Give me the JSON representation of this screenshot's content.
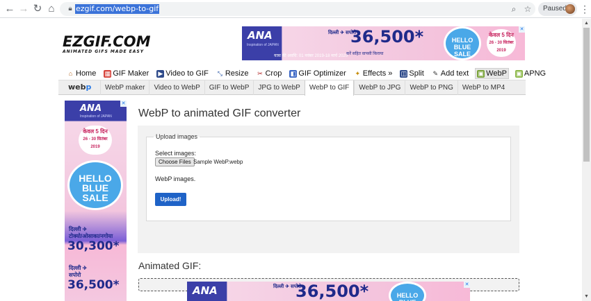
{
  "browser": {
    "back_icon": "back-arrow-icon",
    "forward_icon": "forward-arrow-icon",
    "reload_icon": "reload-icon",
    "home_icon": "home-icon",
    "url": "ezgif.com/webp-to-gif",
    "profile_status": "Paused"
  },
  "site": {
    "logo_word": "EZGIF.COM",
    "logo_tagline": "ANIMATED GIFS MADE EASY"
  },
  "ad_top": {
    "brand": "ANA",
    "tagline": "Inspiration of JAPAN",
    "city": "दिल्ली ✈ सपोरो",
    "price": "36,500*",
    "note": "करें सहित वापसी किराया",
    "period": "यात्रा की अवधि: 01 नवंबर 2019-18 मार्च 2020",
    "sale_line1": "HELLO",
    "sale_line2": "BLUE",
    "sale_line3": "SALE",
    "days": "केवल 5 दिन",
    "dates": "26 - 30 सितंबर 2019"
  },
  "menu": [
    {
      "label": "Home",
      "icon": "home-icon"
    },
    {
      "label": "GIF Maker",
      "icon": "gif-maker-icon"
    },
    {
      "label": "Video to GIF",
      "icon": "video-icon"
    },
    {
      "label": "Resize",
      "icon": "resize-icon"
    },
    {
      "label": "Crop",
      "icon": "crop-icon"
    },
    {
      "label": "GIF Optimizer",
      "icon": "optimizer-icon"
    },
    {
      "label": "Effects »",
      "icon": "effects-icon"
    },
    {
      "label": "Split",
      "icon": "split-icon"
    },
    {
      "label": "Add text",
      "icon": "add-text-icon"
    },
    {
      "label": "WebP",
      "icon": "webp-icon",
      "active": true
    },
    {
      "label": "APNG",
      "icon": "apng-icon"
    }
  ],
  "subnav": {
    "logo_left": "web",
    "logo_right": "p",
    "tabs": [
      {
        "label": "WebP maker"
      },
      {
        "label": "Video to WebP"
      },
      {
        "label": "GIF to WebP"
      },
      {
        "label": "JPG to WebP"
      },
      {
        "label": "WebP to GIF",
        "active": true
      },
      {
        "label": "WebP to JPG"
      },
      {
        "label": "WebP to PNG"
      },
      {
        "label": "WebP to MP4"
      }
    ]
  },
  "side_ad": {
    "brand": "ANA",
    "tagline": "Inspiration of JAPAN",
    "days": "केवल 5 दिन",
    "dates": "26 - 30 सितंबर 2019",
    "sale": "HELLO BLUE SALE",
    "city1": "दिल्ली ✈",
    "city2": "टोक्यो/ओसाका/नगोया",
    "price1": "30,300*",
    "city3": "दिल्ली ✈",
    "city4": "सपोरो",
    "price2": "36,500*"
  },
  "main": {
    "title": "WebP to animated GIF converter",
    "upload_legend": "Upload images",
    "select_label": "Select images:",
    "choose_button": "Choose Files",
    "chosen_file": "Sample WebP.webp",
    "help_text": "WebP images.",
    "upload_button": "Upload!",
    "output_title": "Animated GIF:"
  },
  "ad_bottom": {
    "brand": "ANA",
    "city": "दिल्ली ✈ सपोरो",
    "price": "36,500*",
    "sale": "HELLO BLUE"
  },
  "colors": {
    "primary_button": "#1f63c7",
    "ad_navy": "#3b3fa8",
    "ad_pink": "#f3c6de"
  }
}
